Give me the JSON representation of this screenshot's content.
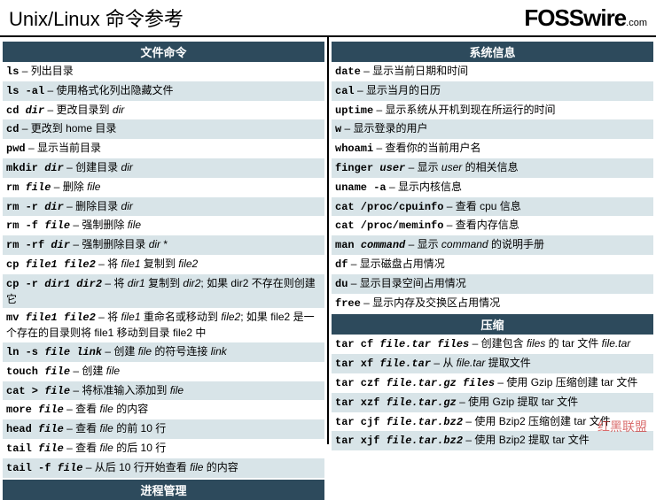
{
  "header": {
    "title": "Unix/Linux 命令参考",
    "brand": "FOSSwire",
    "brand_suffix": ".com"
  },
  "left": {
    "s1_title": "文件命令",
    "s1_rows": [
      {
        "cmd": "ls",
        "arg": "",
        "desc": " – 列出目录"
      },
      {
        "cmd": "ls -al",
        "arg": "",
        "desc": " – 使用格式化列出隐藏文件"
      },
      {
        "cmd": "cd ",
        "arg": "dir",
        "desc": " – 更改目录到 ",
        "desc_arg": "dir"
      },
      {
        "cmd": "cd",
        "arg": "",
        "desc": " – 更改到 home 目录"
      },
      {
        "cmd": "pwd",
        "arg": "",
        "desc": " – 显示当前目录"
      },
      {
        "cmd": "mkdir ",
        "arg": "dir",
        "desc": " – 创建目录 ",
        "desc_arg": "dir"
      },
      {
        "cmd": "rm ",
        "arg": "file",
        "desc": " – 删除 ",
        "desc_arg": "file"
      },
      {
        "cmd": "rm -r ",
        "arg": "dir",
        "desc": " – 删除目录 ",
        "desc_arg": "dir"
      },
      {
        "cmd": "rm -f ",
        "arg": "file",
        "desc": " – 强制删除 ",
        "desc_arg": "file"
      },
      {
        "cmd": "rm -rf ",
        "arg": "dir",
        "desc": " – 强制删除目录 ",
        "desc_arg": "dir",
        "suffix": " *"
      },
      {
        "cmd": "cp ",
        "arg": "file1 file2",
        "desc": " – 将 ",
        "desc_arg": "file1",
        "suffix": " 复制到 ",
        "suffix_arg": "file2"
      },
      {
        "cmd": "cp -r ",
        "arg": "dir1 dir2",
        "desc": " – 将 ",
        "desc_arg": "dir1",
        "suffix": " 复制到 ",
        "suffix_arg": "dir2",
        "tail": "; 如果 dir2 不存在则创建它"
      },
      {
        "cmd": "mv ",
        "arg": "file1 file2",
        "desc": " – 将 ",
        "desc_arg": "file1",
        "suffix": " 重命名或移动到 ",
        "suffix_arg": "file2",
        "tail": "; 如果 file2 是一个存在的目录则将 file1 移动到目录 file2 中"
      },
      {
        "cmd": "ln -s ",
        "arg": "file link",
        "desc": " – 创建 ",
        "desc_arg": "file",
        "suffix": " 的符号连接 ",
        "suffix_arg": "link"
      },
      {
        "cmd": "touch ",
        "arg": "file",
        "desc": " – 创建 ",
        "desc_arg": "file"
      },
      {
        "cmd": "cat > ",
        "arg": "file",
        "desc": " – 将标准输入添加到 ",
        "desc_arg": "file"
      },
      {
        "cmd": "more ",
        "arg": "file",
        "desc": " – 查看 ",
        "desc_arg": "file",
        "suffix": " 的内容"
      },
      {
        "cmd": "head ",
        "arg": "file",
        "desc": " – 查看 ",
        "desc_arg": "file",
        "suffix": " 的前 10 行"
      },
      {
        "cmd": "tail ",
        "arg": "file",
        "desc": " – 查看 ",
        "desc_arg": "file",
        "suffix": " 的后 10 行"
      },
      {
        "cmd": "tail -f ",
        "arg": "file",
        "desc": " – 从后 10 行开始查看 ",
        "desc_arg": "file",
        "suffix": " 的内容"
      }
    ],
    "s2_title": "进程管理"
  },
  "right": {
    "s1_title": "系统信息",
    "s1_rows": [
      {
        "cmd": "date",
        "arg": "",
        "desc": " – 显示当前日期和时间"
      },
      {
        "cmd": "cal",
        "arg": "",
        "desc": " – 显示当月的日历"
      },
      {
        "cmd": "uptime",
        "arg": "",
        "desc": " – 显示系统从开机到现在所运行的时间"
      },
      {
        "cmd": "w",
        "arg": "",
        "desc": " – 显示登录的用户"
      },
      {
        "cmd": "whoami",
        "arg": "",
        "desc": " – 查看你的当前用户名"
      },
      {
        "cmd": "finger ",
        "arg": "user",
        "desc": " – 显示 ",
        "desc_arg": "user",
        "suffix": " 的相关信息"
      },
      {
        "cmd": "uname -a",
        "arg": "",
        "desc": " – 显示内核信息"
      },
      {
        "cmd": "cat /proc/cpuinfo",
        "arg": "",
        "desc": " – 查看 cpu 信息"
      },
      {
        "cmd": "cat /proc/meminfo",
        "arg": "",
        "desc": " – 查看内存信息"
      },
      {
        "cmd": "man ",
        "arg": "command",
        "desc": " – 显示 ",
        "desc_arg": "command",
        "suffix": " 的说明手册"
      },
      {
        "cmd": "df",
        "arg": "",
        "desc": " – 显示磁盘占用情况"
      },
      {
        "cmd": "du",
        "arg": "",
        "desc": " – 显示目录空间占用情况"
      },
      {
        "cmd": "free",
        "arg": "",
        "desc": " – 显示内存及交换区占用情况"
      }
    ],
    "s2_title": "压缩",
    "s2_rows": [
      {
        "cmd": "tar cf ",
        "arg": "file.tar files",
        "desc": " – 创建包含 ",
        "desc_arg": "files",
        "suffix": " 的 tar 文件 ",
        "suffix_arg": "file.tar"
      },
      {
        "cmd": "tar xf ",
        "arg": "file.tar",
        "desc": " – 从 ",
        "desc_arg": "file.tar",
        "suffix": " 提取文件"
      },
      {
        "cmd": "tar czf ",
        "arg": "file.tar.gz files",
        "desc": " – 使用 Gzip 压缩创建 tar 文件"
      },
      {
        "cmd": "tar xzf ",
        "arg": "file.tar.gz",
        "desc": " – 使用 Gzip 提取 tar 文件"
      },
      {
        "cmd": "tar cjf ",
        "arg": "file.tar.bz2",
        "desc": " – 使用 Bzip2 压缩创建 tar 文件"
      },
      {
        "cmd": "tar xjf ",
        "arg": "file.tar.bz2",
        "desc": " – 使用 Bzip2 提取 tar 文件"
      }
    ]
  },
  "watermark": "红黑联盟"
}
